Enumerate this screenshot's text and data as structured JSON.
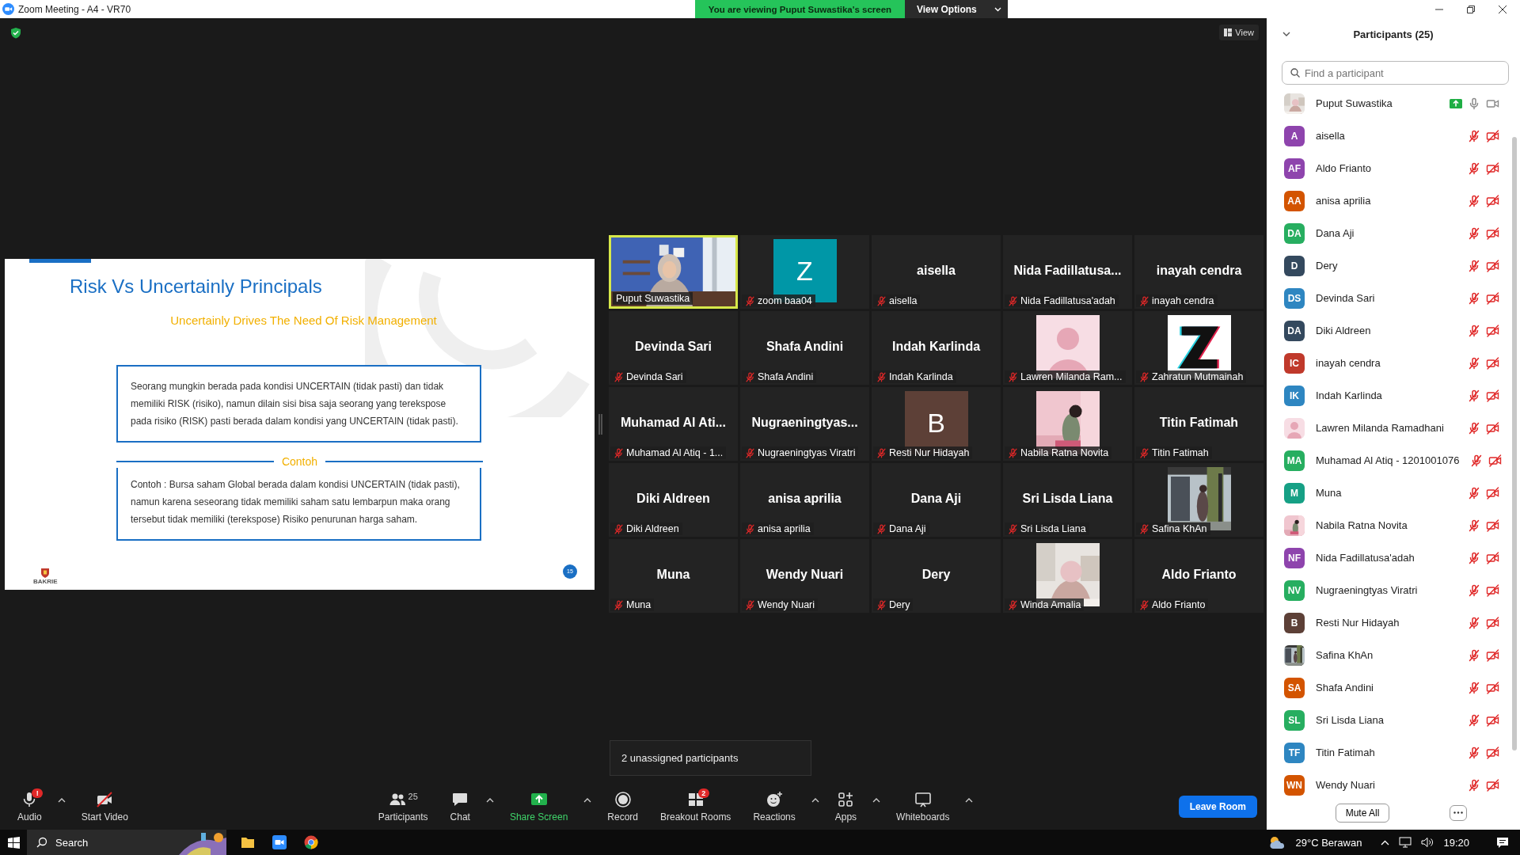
{
  "window": {
    "title": "Zoom Meeting - A4 - VR70"
  },
  "banner": {
    "text": "You are viewing Puput Suwastika's screen",
    "button": "View Options"
  },
  "view_button": "View",
  "slide": {
    "title": "Risk Vs Uncertainly Principals",
    "subtitle": "Uncertainly Drives The Need Of Risk Management",
    "box_text": "Seorang mungkin berada pada kondisi UNCERTAIN (tidak pasti) dan tidak memiliki RISK (risiko), namun dilain sisi bisa saja seorang yang terekspose pada risiko (RISK) pasti berada dalam kondisi yang UNCERTAIN (tidak pasti).",
    "section_label": "Contoh",
    "example_text": "Contoh : Bursa saham Global berada dalam kondisi UNCERTAIN (tidak pasti), namun karena seseorang tidak memiliki saham satu lembarpun maka orang tersebut tidak memiliki (terekspose) Risiko penurunan harga saham.",
    "logo_text": "BAKRIE",
    "page_number": "15"
  },
  "tiles": [
    {
      "kind": "video",
      "label": "Puput Suwastika",
      "muted": false,
      "speaking": true
    },
    {
      "kind": "avatar",
      "letter": "Z",
      "color": "#0097a7",
      "label": "zoom baa04",
      "muted": true,
      "speaking": false
    },
    {
      "kind": "name",
      "title": "aisella",
      "label": "aisella",
      "muted": true,
      "speaking": false
    },
    {
      "kind": "name",
      "title": "Nida Fadillatusa...",
      "label": "Nida Fadillatusa'adah",
      "muted": true,
      "speaking": false
    },
    {
      "kind": "name",
      "title": "inayah cendra",
      "label": "inayah cendra",
      "muted": true,
      "speaking": false
    },
    {
      "kind": "name",
      "title": "Devinda Sari",
      "label": "Devinda Sari",
      "muted": true,
      "speaking": false
    },
    {
      "kind": "name",
      "title": "Shafa Andini",
      "label": "Shafa Andini",
      "muted": true,
      "speaking": false
    },
    {
      "kind": "name",
      "title": "Indah Karlinda",
      "label": "Indah Karlinda",
      "muted": true,
      "speaking": false
    },
    {
      "kind": "silhouette",
      "label": "Lawren Milanda Ram...",
      "muted": true,
      "speaking": false
    },
    {
      "kind": "picture",
      "label": "Zahratun Mutmainah",
      "muted": true,
      "speaking": false
    },
    {
      "kind": "name",
      "title": "Muhamad Al Ati...",
      "label": "Muhamad Al Atiq - 1...",
      "muted": true,
      "speaking": false
    },
    {
      "kind": "name",
      "title": "Nugraeningtyas...",
      "label": "Nugraeningtyas Viratri",
      "muted": true,
      "speaking": false
    },
    {
      "kind": "avatar",
      "letter": "B",
      "color": "#5d4037",
      "label": "Resti Nur Hidayah",
      "muted": true,
      "speaking": false
    },
    {
      "kind": "picture",
      "label": "Nabila Ratna Novita",
      "muted": true,
      "speaking": false
    },
    {
      "kind": "name",
      "title": "Titin Fatimah",
      "label": "Titin Fatimah",
      "muted": true,
      "speaking": false
    },
    {
      "kind": "name",
      "title": "Diki Aldreen",
      "label": "Diki Aldreen",
      "muted": true,
      "speaking": false
    },
    {
      "kind": "name",
      "title": "anisa aprilia",
      "label": "anisa aprilia",
      "muted": true,
      "speaking": false
    },
    {
      "kind": "name",
      "title": "Dana Aji",
      "label": "Dana Aji",
      "muted": true,
      "speaking": false
    },
    {
      "kind": "name",
      "title": "Sri Lisda Liana",
      "label": "Sri Lisda Liana",
      "muted": true,
      "speaking": false
    },
    {
      "kind": "picture",
      "label": "Safina KhAn",
      "muted": true,
      "speaking": false
    },
    {
      "kind": "name",
      "title": "Muna",
      "label": "Muna",
      "muted": true,
      "speaking": false
    },
    {
      "kind": "name",
      "title": "Wendy Nuari",
      "label": "Wendy Nuari",
      "muted": true,
      "speaking": false
    },
    {
      "kind": "name",
      "title": "Dery",
      "label": "Dery",
      "muted": true,
      "speaking": false
    },
    {
      "kind": "picture",
      "label": "Winda Amalia",
      "muted": true,
      "speaking": false
    },
    {
      "kind": "name",
      "title": "Aldo Frianto",
      "label": "Aldo Frianto",
      "muted": true,
      "speaking": false
    }
  ],
  "tooltip": "2 unassigned participants",
  "toolbar": {
    "left": [
      {
        "kind": "audio",
        "label": "Audio",
        "badge": "!",
        "caret": true,
        "accent": false
      },
      {
        "kind": "video",
        "label": "Start Video",
        "caret": false,
        "accent": false
      }
    ],
    "center": [
      {
        "kind": "participants",
        "label": "Participants",
        "count": "25",
        "caret": false,
        "accent": false
      },
      {
        "kind": "chat",
        "label": "Chat",
        "caret": true,
        "accent": false
      },
      {
        "kind": "share",
        "label": "Share Screen",
        "caret": true,
        "accent": true
      },
      {
        "kind": "record",
        "label": "Record",
        "caret": false,
        "accent": false
      },
      {
        "kind": "breakout",
        "label": "Breakout Rooms",
        "badge": "2",
        "caret": false,
        "accent": false
      },
      {
        "kind": "reactions",
        "label": "Reactions",
        "caret": true,
        "accent": false
      },
      {
        "kind": "apps",
        "label": "Apps",
        "caret": true,
        "accent": false
      },
      {
        "kind": "whiteboards",
        "label": "Whiteboards",
        "caret": true,
        "accent": false
      }
    ],
    "leave_button": "Leave Room"
  },
  "panel": {
    "title": "Participants (25)",
    "search": {
      "placeholder": "Find a participant"
    },
    "participants": [
      {
        "name": "Puput Suwastika",
        "sharing": true,
        "muted": false,
        "video_off": false
      },
      {
        "name": "aisella",
        "kind": "initials",
        "initials": "A",
        "color": "#8e44ad",
        "sharing": false,
        "muted": true,
        "video_off": true
      },
      {
        "name": "Aldo Frianto",
        "kind": "initials",
        "initials": "AF",
        "color": "#8e44ad",
        "sharing": false,
        "muted": true,
        "video_off": true
      },
      {
        "name": "anisa aprilia",
        "kind": "initials",
        "initials": "AA",
        "color": "#d35400",
        "sharing": false,
        "muted": true,
        "video_off": true
      },
      {
        "name": "Dana Aji",
        "kind": "initials",
        "initials": "DA",
        "color": "#27ae60",
        "sharing": false,
        "muted": true,
        "video_off": true
      },
      {
        "name": "Dery",
        "kind": "initials",
        "initials": "D",
        "color": "#34495e",
        "sharing": false,
        "muted": true,
        "video_off": true
      },
      {
        "name": "Devinda Sari",
        "kind": "initials",
        "initials": "DS",
        "color": "#2e86c1",
        "sharing": false,
        "muted": true,
        "video_off": true
      },
      {
        "name": "Diki Aldreen",
        "kind": "initials",
        "initials": "DA",
        "color": "#34495e",
        "sharing": false,
        "muted": true,
        "video_off": true
      },
      {
        "name": "inayah cendra",
        "kind": "initials",
        "initials": "IC",
        "color": "#c0392b",
        "sharing": false,
        "muted": true,
        "video_off": true
      },
      {
        "name": "Indah Karlinda",
        "kind": "initials",
        "initials": "IK",
        "color": "#2e86c1",
        "sharing": false,
        "muted": true,
        "video_off": true
      },
      {
        "name": "Lawren Milanda Ramadhani",
        "kind": "silhouette",
        "sharing": false,
        "muted": true,
        "video_off": true
      },
      {
        "name": "Muhamad Al Atiq - 1201001076",
        "kind": "initials",
        "initials": "MA",
        "color": "#27ae60",
        "sharing": false,
        "muted": true,
        "video_off": true
      },
      {
        "name": "Muna",
        "kind": "initials",
        "initials": "M",
        "color": "#16a085",
        "sharing": false,
        "muted": true,
        "video_off": true
      },
      {
        "name": "Nabila Ratna Novita",
        "sharing": false,
        "muted": true,
        "video_off": true
      },
      {
        "name": "Nida Fadillatusa'adah",
        "kind": "initials",
        "initials": "NF",
        "color": "#8e44ad",
        "sharing": false,
        "muted": true,
        "video_off": true
      },
      {
        "name": "Nugraeningtyas Viratri",
        "kind": "initials",
        "initials": "NV",
        "color": "#27ae60",
        "sharing": false,
        "muted": true,
        "video_off": true
      },
      {
        "name": "Resti Nur Hidayah",
        "kind": "initials",
        "initials": "B",
        "color": "#5d4037",
        "sharing": false,
        "muted": true,
        "video_off": true
      },
      {
        "name": "Safina KhAn",
        "sharing": false,
        "muted": true,
        "video_off": true
      },
      {
        "name": "Shafa Andini",
        "kind": "initials",
        "initials": "SA",
        "color": "#d35400",
        "sharing": false,
        "muted": true,
        "video_off": true
      },
      {
        "name": "Sri Lisda Liana",
        "kind": "initials",
        "initials": "SL",
        "color": "#27ae60",
        "sharing": false,
        "muted": true,
        "video_off": true
      },
      {
        "name": "Titin Fatimah",
        "kind": "initials",
        "initials": "TF",
        "color": "#2e86c1",
        "sharing": false,
        "muted": true,
        "video_off": true
      },
      {
        "name": "Wendy Nuari",
        "kind": "initials",
        "initials": "WN",
        "color": "#d35400",
        "sharing": false,
        "muted": true,
        "video_off": true
      }
    ],
    "buttons": {
      "mute_all": "Mute All"
    }
  },
  "taskbar": {
    "search": "Search",
    "weather": "29°C Berawan",
    "time": "19:20"
  }
}
